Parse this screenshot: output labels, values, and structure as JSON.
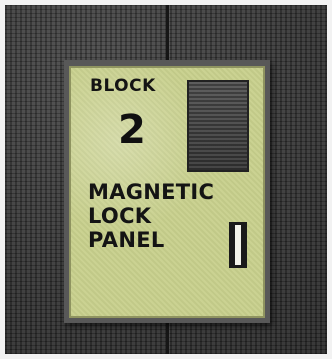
{
  "panel": {
    "block_label": "BLOCK",
    "block_number": "2",
    "title_lines": [
      "MAGNETIC",
      "LOCK",
      "PANEL"
    ]
  },
  "colors": {
    "plate": "#c9d18e",
    "panel_frame": "#585858",
    "wall": "#3a3a3a",
    "text": "#141414"
  },
  "icons": {
    "display": "block-display-screen",
    "switch": "lock-switch-icon"
  }
}
